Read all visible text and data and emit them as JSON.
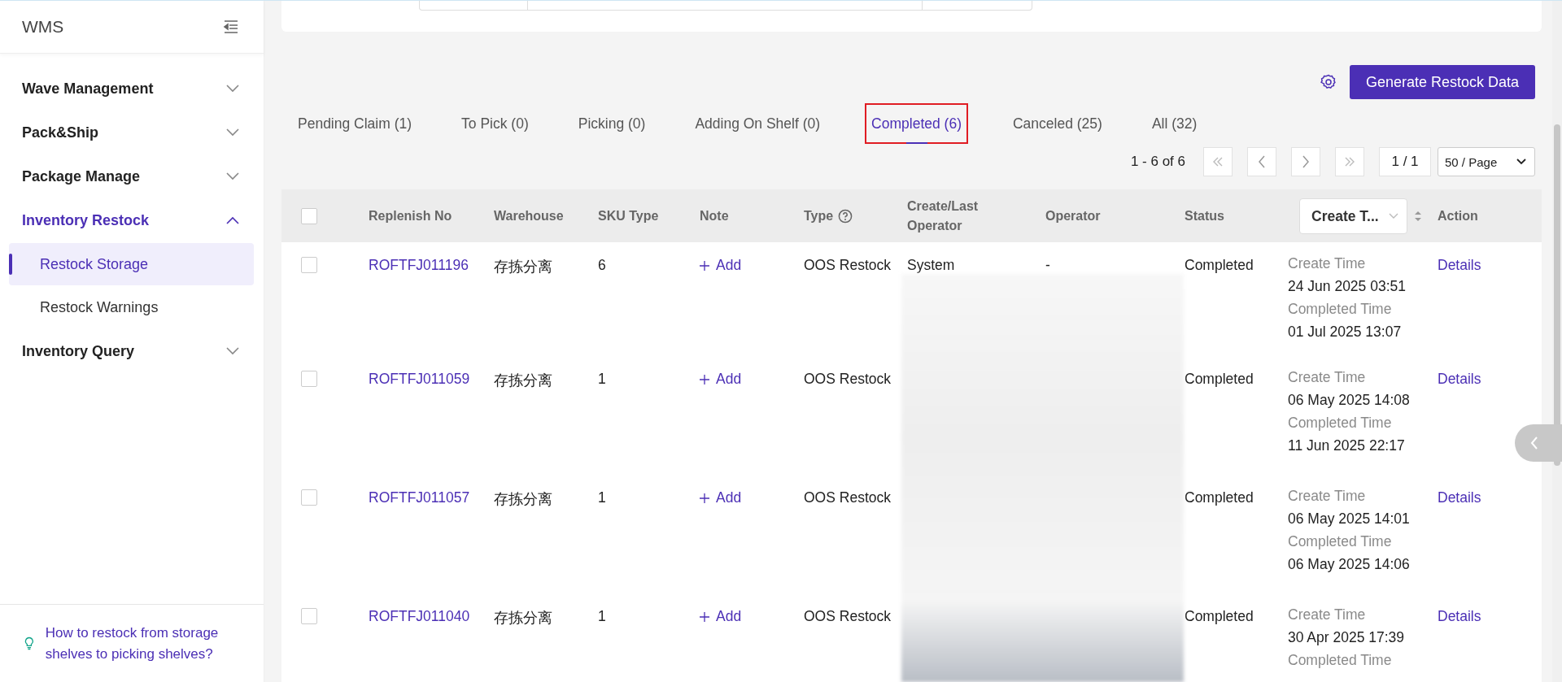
{
  "sidebar": {
    "title": "WMS",
    "items": [
      {
        "label": "Wave Management",
        "expanded": false
      },
      {
        "label": "Pack&Ship",
        "expanded": false
      },
      {
        "label": "Package Manage",
        "expanded": false
      },
      {
        "label": "Inventory Restock",
        "expanded": true,
        "children": [
          {
            "label": "Restock Storage",
            "selected": true
          },
          {
            "label": "Restock Warnings",
            "selected": false
          }
        ]
      },
      {
        "label": "Inventory Query",
        "expanded": false
      }
    ],
    "help_link": "How to restock from storage shelves to picking shelves?"
  },
  "toolbar": {
    "generate_button": "Generate Restock Data"
  },
  "tabs": [
    {
      "label": "Pending Claim (1)",
      "selected": false
    },
    {
      "label": "To Pick (0)",
      "selected": false
    },
    {
      "label": "Picking (0)",
      "selected": false
    },
    {
      "label": "Adding On Shelf (0)",
      "selected": false
    },
    {
      "label": "Completed (6)",
      "selected": true
    },
    {
      "label": "Canceled (25)",
      "selected": false
    },
    {
      "label": "All (32)",
      "selected": false
    }
  ],
  "pagination": {
    "range": "1 - 6 of 6",
    "page": "1 / 1",
    "page_size": "50 / Page"
  },
  "table": {
    "all_checked": false,
    "columns": [
      {
        "label": "Replenish No",
        "kind": "text"
      },
      {
        "label": "Warehouse",
        "kind": "text"
      },
      {
        "label": "SKU Type",
        "kind": "text"
      },
      {
        "label": "Note",
        "kind": "text"
      },
      {
        "label": "Type",
        "kind": "help"
      },
      {
        "label": "Create/Last Operator",
        "kind": "text"
      },
      {
        "label": "Operator",
        "kind": "text"
      },
      {
        "label": "Status",
        "kind": "text"
      },
      {
        "label": "Create T...",
        "kind": "select"
      },
      {
        "label": "Action",
        "kind": "text"
      }
    ],
    "rows": [
      {
        "checked": false,
        "replenish_no": "ROFTFJ011196",
        "warehouse": "存拣分离",
        "sku_type": "6",
        "note": "Add",
        "type": "OOS Restock",
        "create_operator": "System",
        "operator": "-",
        "status": "Completed",
        "times": [
          {
            "label": "Create Time",
            "value": "24 Jun 2025 03:51"
          },
          {
            "label": "Completed Time",
            "value": "01 Jul 2025 13:07"
          }
        ],
        "action": "Details"
      },
      {
        "checked": false,
        "replenish_no": "ROFTFJ011059",
        "warehouse": "存拣分离",
        "sku_type": "1",
        "note": "Add",
        "type": "OOS Restock",
        "status": "Completed",
        "times": [
          {
            "label": "Create Time",
            "value": "06 May 2025 14:08"
          },
          {
            "label": "Completed Time",
            "value": "11 Jun 2025 22:17"
          }
        ],
        "action": "Details"
      },
      {
        "checked": false,
        "replenish_no": "ROFTFJ011057",
        "warehouse": "存拣分离",
        "sku_type": "1",
        "note": "Add",
        "type": "OOS Restock",
        "status": "Completed",
        "times": [
          {
            "label": "Create Time",
            "value": "06 May 2025 14:01"
          },
          {
            "label": "Completed Time",
            "value": "06 May 2025 14:06"
          }
        ],
        "action": "Details"
      },
      {
        "checked": false,
        "replenish_no": "ROFTFJ011040",
        "warehouse": "存拣分离",
        "sku_type": "1",
        "note": "Add",
        "type": "OOS Restock",
        "status": "Completed",
        "times": [
          {
            "label": "Create Time",
            "value": "30 Apr 2025 17:39"
          },
          {
            "label": "Completed Time"
          }
        ],
        "action": "Details"
      }
    ]
  }
}
